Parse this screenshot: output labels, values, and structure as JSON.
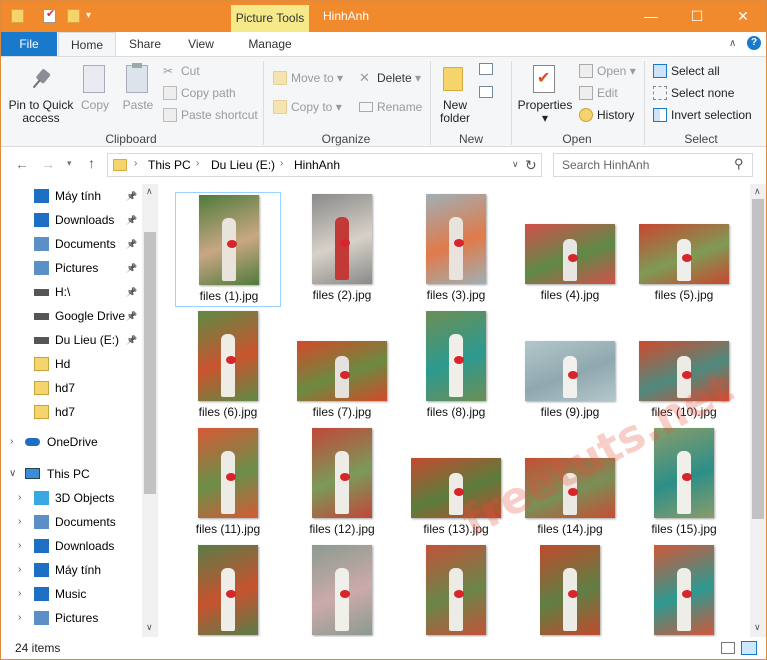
{
  "title_bar": {
    "context_tab": "Picture Tools",
    "window_title": "HinhAnh",
    "minimize": "—",
    "maximize": "☐",
    "close": "✕"
  },
  "ribbon_tabs": [
    "File",
    "Home",
    "Share",
    "View",
    "Manage"
  ],
  "clipboard": {
    "pin": "Pin to Quick access",
    "copy": "Copy",
    "paste": "Paste",
    "cut": "Cut",
    "copy_path": "Copy path",
    "paste_shortcut": "Paste shortcut",
    "label": "Clipboard"
  },
  "organize": {
    "move_to": "Move to",
    "copy_to": "Copy to",
    "delete": "Delete",
    "rename": "Rename",
    "label": "Organize"
  },
  "new_group": {
    "new_folder": "New folder",
    "label": "New"
  },
  "open_group": {
    "properties": "Properties",
    "open": "Open",
    "edit": "Edit",
    "history": "History",
    "label": "Open"
  },
  "select_group": {
    "select_all": "Select all",
    "select_none": "Select none",
    "invert": "Invert selection",
    "label": "Select"
  },
  "address": {
    "crumbs": [
      "This PC",
      "Du Lieu (E:)",
      "HinhAnh"
    ],
    "search_placeholder": "Search HinhAnh"
  },
  "nav": {
    "quick": [
      {
        "label": "Máy tính",
        "pinned": true
      },
      {
        "label": "Downloads",
        "pinned": true
      },
      {
        "label": "Documents",
        "pinned": true
      },
      {
        "label": "Pictures",
        "pinned": true
      },
      {
        "label": "H:\\",
        "pinned": true
      },
      {
        "label": "Google Drive",
        "pinned": true
      },
      {
        "label": "Du Lieu (E:)",
        "pinned": true
      },
      {
        "label": "Hd",
        "pinned": false
      },
      {
        "label": "hd7",
        "pinned": false
      },
      {
        "label": "hd7",
        "pinned": false
      }
    ],
    "onedrive": "OneDrive",
    "this_pc": "This PC",
    "pc_items": [
      "3D Objects",
      "Documents",
      "Downloads",
      "Máy tính",
      "Music",
      "Pictures"
    ]
  },
  "files": [
    "files (1).jpg",
    "files (2).jpg",
    "files (3).jpg",
    "files (4).jpg",
    "files (5).jpg",
    "files (6).jpg",
    "files (7).jpg",
    "files (8).jpg",
    "files (9).jpg",
    "files (10).jpg",
    "files (11).jpg",
    "files (12).jpg",
    "files (13).jpg",
    "files (14).jpg",
    "files (15).jpg",
    "",
    "",
    "",
    "",
    ""
  ],
  "watermark": "freetuts.net",
  "status": {
    "count": "24 items"
  },
  "colors": {
    "title": "#f08a2c",
    "file_tab": "#1979ca",
    "selection": "#cce8ff"
  }
}
